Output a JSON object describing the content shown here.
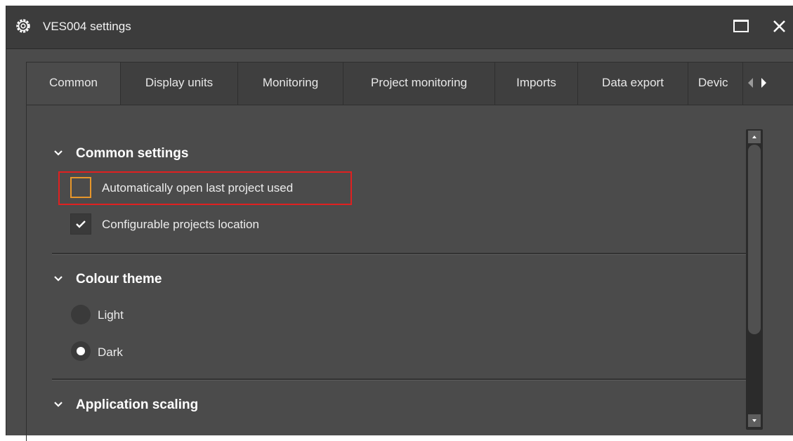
{
  "window": {
    "title": "VES004 settings"
  },
  "tabs": [
    {
      "label": "Common",
      "active": true
    },
    {
      "label": "Display units",
      "active": false
    },
    {
      "label": "Monitoring",
      "active": false
    },
    {
      "label": "Project monitoring",
      "active": false
    },
    {
      "label": "Imports",
      "active": false
    },
    {
      "label": "Data export",
      "active": false
    },
    {
      "label": "Devic",
      "active": false
    }
  ],
  "sections": {
    "common": {
      "title": "Common settings",
      "options": [
        {
          "label": "Automatically open last project used",
          "checked": false
        },
        {
          "label": "Configurable projects location",
          "checked": true
        }
      ]
    },
    "theme": {
      "title": "Colour theme",
      "options": [
        {
          "label": "Light",
          "selected": false
        },
        {
          "label": "Dark",
          "selected": true
        }
      ]
    },
    "scaling": {
      "title": "Application scaling"
    }
  },
  "icons": {
    "title": "gear-icon",
    "maximize": "maximize-icon",
    "close": "close-icon",
    "tab_prev": "triangle-left-icon",
    "tab_next": "triangle-right-icon",
    "section_toggle": "chevron-down-icon",
    "checkmark": "checkmark-icon"
  },
  "colors": {
    "background": "#4b4b4b",
    "titlebar": "#3c3c3c",
    "focus_outline": "#e6962b",
    "highlight": "#e02020"
  }
}
